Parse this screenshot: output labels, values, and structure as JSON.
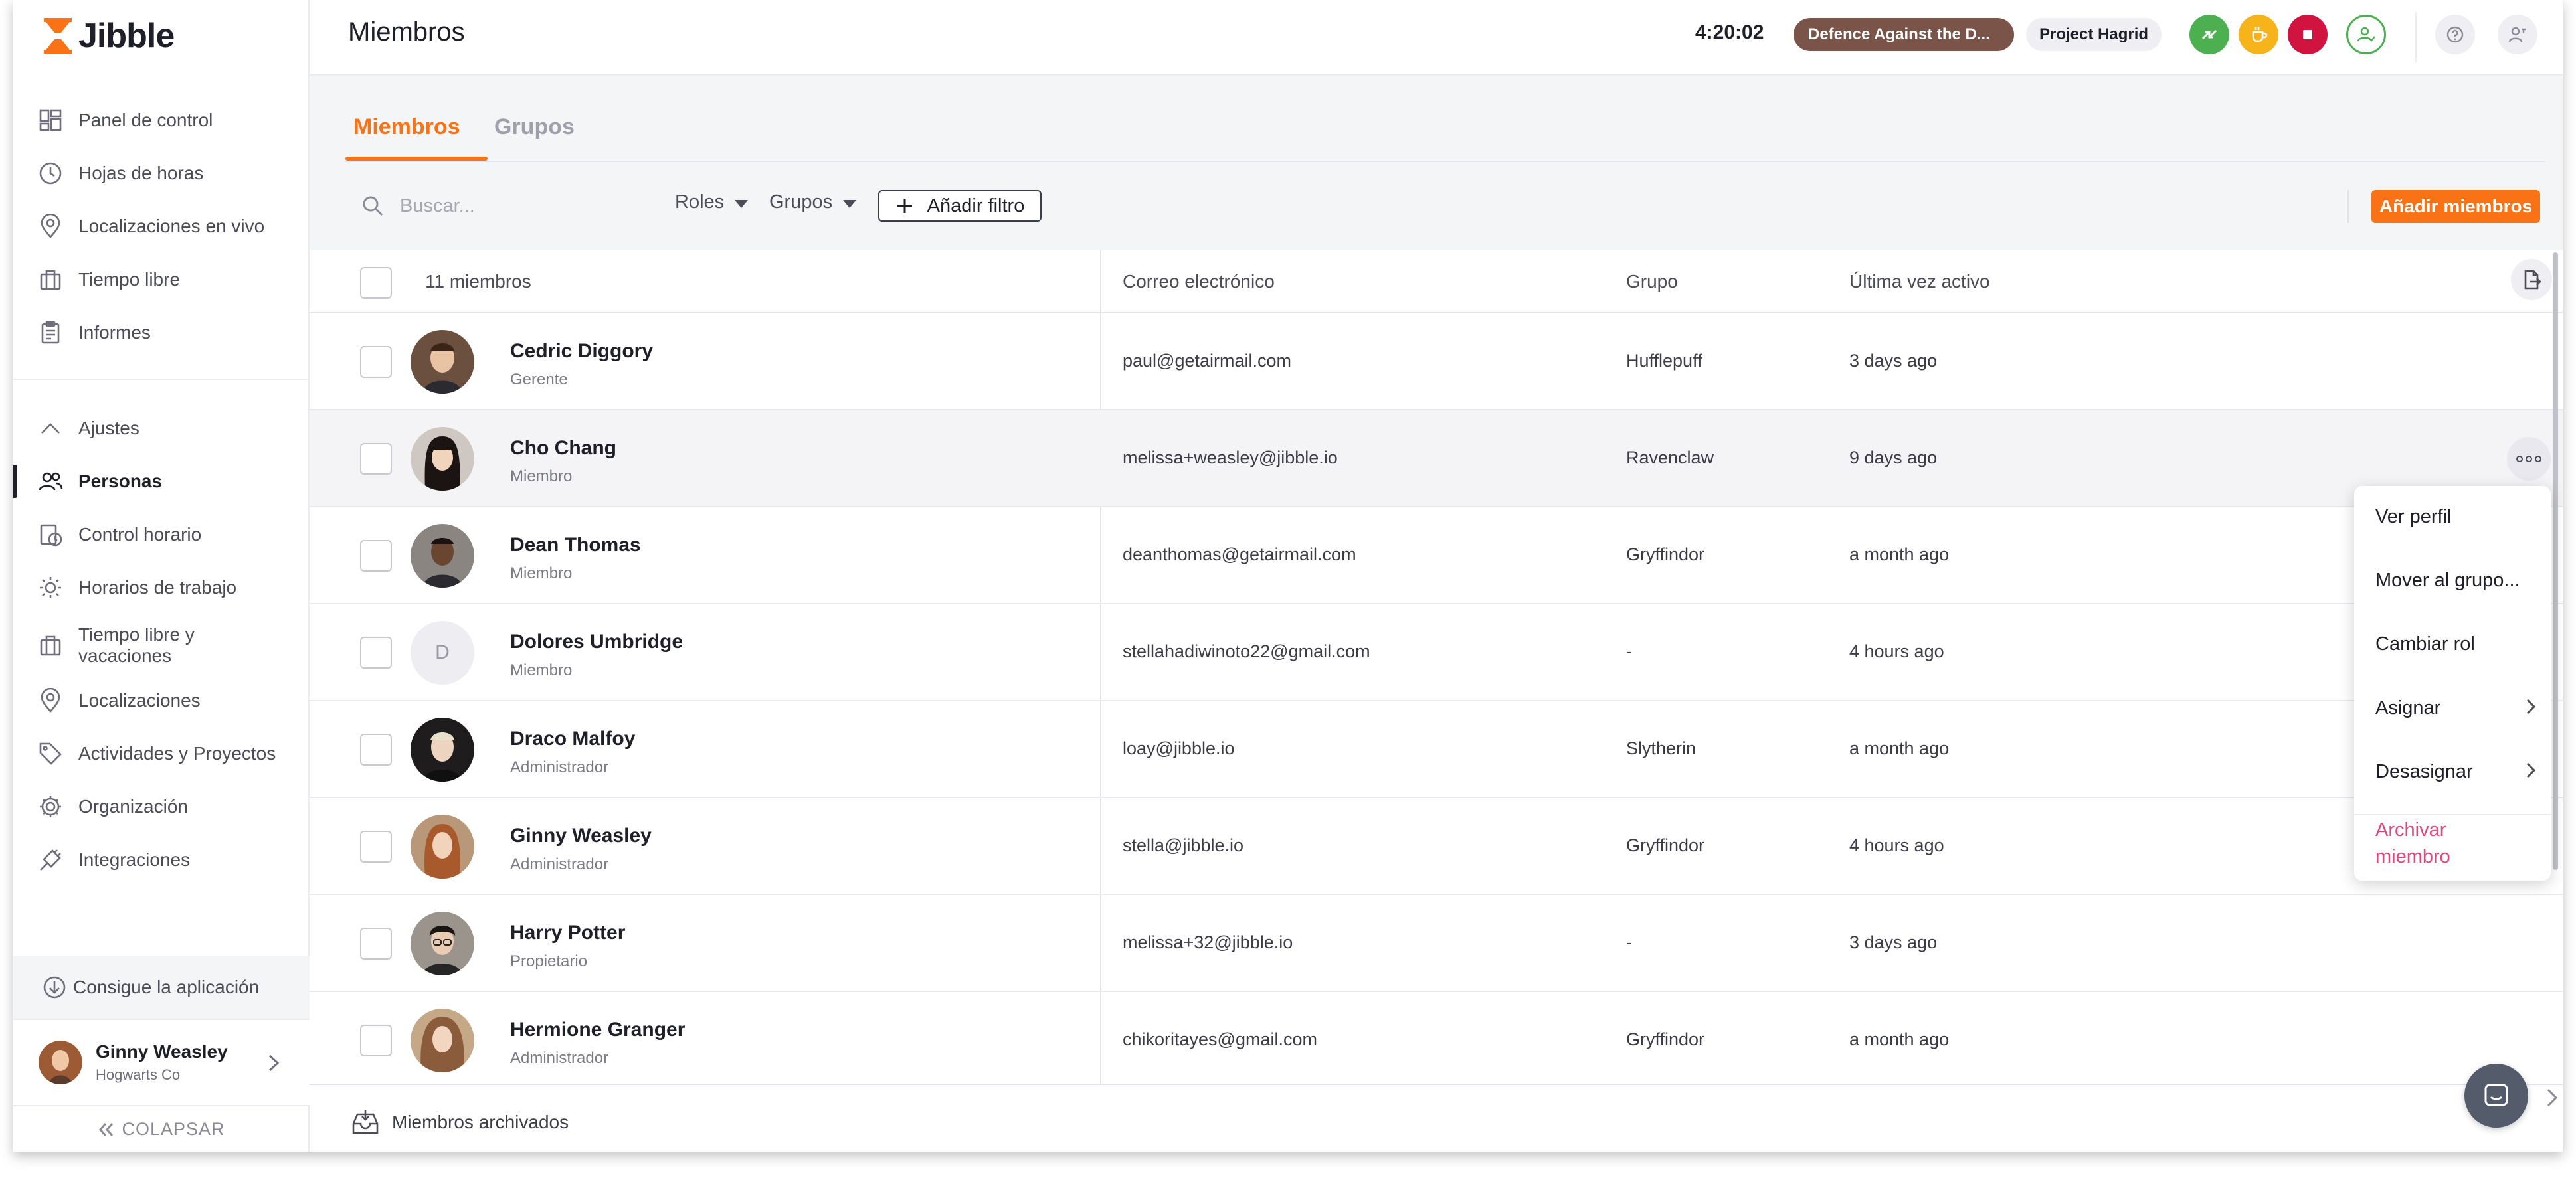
{
  "app": {
    "name": "Jibble"
  },
  "sidebar": {
    "items": [
      {
        "label": "Panel de control",
        "icon": "dashboard-icon"
      },
      {
        "label": "Hojas de horas",
        "icon": "clock-icon"
      },
      {
        "label": "Localizaciones en vivo",
        "icon": "location-pin-icon"
      },
      {
        "label": "Tiempo libre",
        "icon": "suitcase-icon"
      },
      {
        "label": "Informes",
        "icon": "clipboard-icon"
      }
    ],
    "settings_label": "Ajustes",
    "settings_items": [
      {
        "label": "Personas",
        "icon": "people-icon",
        "active": true
      },
      {
        "label": "Control horario",
        "icon": "time-tracking-icon"
      },
      {
        "label": "Horarios de trabajo",
        "icon": "sun-schedule-icon"
      },
      {
        "label": "Tiempo libre y vacaciones",
        "icon": "suitcase-icon"
      },
      {
        "label": "Localizaciones",
        "icon": "location-pin-icon"
      },
      {
        "label": "Actividades y Proyectos",
        "icon": "tag-icon"
      },
      {
        "label": "Organización",
        "icon": "gear-icon"
      },
      {
        "label": "Integraciones",
        "icon": "plug-icon"
      }
    ],
    "get_app_label": "Consigue la aplicación",
    "user": {
      "name": "Ginny Weasley",
      "org": "Hogwarts Co"
    },
    "collapse_label": "COLAPSAR"
  },
  "header": {
    "title": "Miembros",
    "timer": "4:20:02",
    "activity": "Defence Against the D...",
    "project": "Project Hagrid"
  },
  "tabs": [
    {
      "label": "Miembros",
      "active": true
    },
    {
      "label": "Grupos",
      "active": false
    }
  ],
  "toolbar": {
    "search_placeholder": "Buscar...",
    "roles_label": "Roles",
    "groups_label": "Grupos",
    "add_filter_label": "Añadir filtro",
    "add_members_label": "Añadir miembros"
  },
  "table": {
    "count_label": "11 miembros",
    "columns": {
      "email": "Correo electrónico",
      "group": "Grupo",
      "last_active": "Última vez activo"
    },
    "rows": [
      {
        "name": "Cedric Diggory",
        "role": "Gerente",
        "email": "paul@getairmail.com",
        "group": "Hufflepuff",
        "last_active": "3 days ago",
        "avatar_color": "#6b5040"
      },
      {
        "name": "Cho Chang",
        "role": "Miembro",
        "email": "melissa+weasley@jibble.io",
        "group": "Ravenclaw",
        "last_active": "9 days ago",
        "avatar_color": "#2a1f1c"
      },
      {
        "name": "Dean Thomas",
        "role": "Miembro",
        "email": "deanthomas@getairmail.com",
        "group": "Gryffindor",
        "last_active": "a month ago",
        "avatar_color": "#4a3a30"
      },
      {
        "name": "Dolores Umbridge",
        "role": "Miembro",
        "email": "stellahadiwinoto22@gmail.com",
        "group": "-",
        "last_active": "4 hours ago",
        "avatar_letter": "D"
      },
      {
        "name": "Draco Malfoy",
        "role": "Administrador",
        "email": "loay@jibble.io",
        "group": "Slytherin",
        "last_active": "a month ago",
        "avatar_color": "#3a3532"
      },
      {
        "name": "Ginny Weasley",
        "role": "Administrador",
        "email": "stella@jibble.io",
        "group": "Gryffindor",
        "last_active": "4 hours ago",
        "avatar_color": "#9c5a35"
      },
      {
        "name": "Harry Potter",
        "role": "Propietario",
        "email": "melissa+32@jibble.io",
        "group": "-",
        "last_active": "3 days ago",
        "avatar_color": "#3a3430"
      },
      {
        "name": "Hermione Granger",
        "role": "Administrador",
        "email": "chikoritayes@gmail.com",
        "group": "Gryffindor",
        "last_active": "a month ago",
        "avatar_color": "#8a5c3c"
      }
    ]
  },
  "context_menu": {
    "items": [
      "Ver perfil",
      "Mover al grupo...",
      "Cambiar rol",
      "Asignar",
      "Desasignar"
    ],
    "archive_label": "Archivar miembro"
  },
  "footer": {
    "archived_label": "Miembros archivados"
  },
  "colors": {
    "accent": "#f97316",
    "activity_pill": "#7a5448",
    "danger": "#e0457b",
    "start_green": "#4cb050",
    "break_amber": "#f6b41a",
    "stop_red": "#d0143f"
  }
}
